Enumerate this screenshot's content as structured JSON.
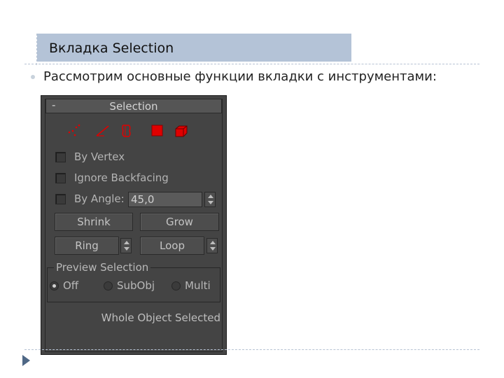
{
  "slide": {
    "title": "Вкладка Selection",
    "bullet": "Рассмотрим основные функции вкладки с инструментами:"
  },
  "panel": {
    "collapse_symbol": "-",
    "rollout_title": "Selection",
    "tool_icons": [
      "vertex-icon",
      "edge-icon",
      "border-icon",
      "polygon-icon",
      "element-icon"
    ],
    "accent_color": "#e00000",
    "options": {
      "by_vertex": {
        "label": "By Vertex",
        "checked": false
      },
      "ignore_backfacing": {
        "label": "Ignore Backfacing",
        "checked": false
      },
      "by_angle": {
        "label": "By Angle:",
        "checked": false,
        "value": "45,0"
      }
    },
    "buttons": {
      "shrink": "Shrink",
      "grow": "Grow",
      "ring": "Ring",
      "loop": "Loop"
    },
    "preview_selection": {
      "label": "Preview Selection",
      "options": [
        "Off",
        "SubObj",
        "Multi"
      ],
      "selected": "Off"
    },
    "status": "Whole Object Selected"
  }
}
